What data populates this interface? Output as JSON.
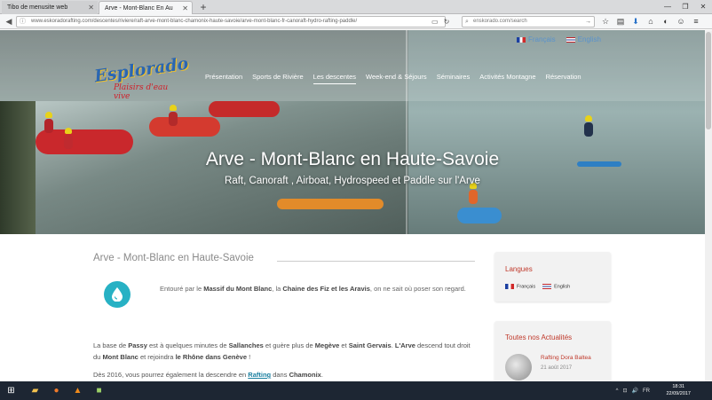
{
  "browser": {
    "tabs": [
      {
        "label": "Tibo de menusite web",
        "active": false
      },
      {
        "label": "Arve - Mont-Blanc En Au",
        "active": true
      }
    ],
    "new_tab_label": "+",
    "window_controls": [
      "—",
      "❐",
      "✕"
    ],
    "url": "www.eskoradorafting.com/descentes/riviere/raft-arve-mont-blanc-chamonix-haute-savoie/arve-mont-blanc-fr-canoraft-hydro-rafting-paddle/",
    "search_text": "enskorado.com/search",
    "icons": {
      "back": "back-icon",
      "reload": "reload-icon",
      "search": "search-icon"
    }
  },
  "site": {
    "languages": [
      {
        "label": "Français",
        "flag": "fr"
      },
      {
        "label": "English",
        "flag": "en"
      }
    ],
    "logo": {
      "line1": "Esplorado",
      "line2": "Plaisirs d'eau vive"
    },
    "nav": [
      {
        "label": "Présentation",
        "active": false
      },
      {
        "label": "Sports de Rivière",
        "active": false
      },
      {
        "label": "Les descentes",
        "active": true
      },
      {
        "label": "Week-end & Séjours",
        "active": false
      },
      {
        "label": "Séminaires",
        "active": false
      },
      {
        "label": "Activités Montagne",
        "active": false
      },
      {
        "label": "Réservation",
        "active": false
      }
    ],
    "hero_title": "Arve - Mont-Blanc en Haute-Savoie",
    "hero_subtitle": "Raft, Canoraft , Airboat, Hydrospeed et Paddle sur l'Arve"
  },
  "content": {
    "section_title": "Arve - Mont-Blanc en Haute-Savoie",
    "intro_a": "Entouré par le ",
    "intro_b": "Massif du Mont Blanc",
    "intro_c": ", la ",
    "intro_d": "Chaine des Fiz et les Aravis",
    "intro_e": ", on ne sait où poser son regard.",
    "p1_a": "La base de ",
    "p1_b": "Passy",
    "p1_c": " est à quelques minutes de ",
    "p1_d": "Sallanches",
    "p1_e": " et guère plus de ",
    "p1_f": "Megève",
    "p1_g": " et ",
    "p1_h": "Saint Gervais",
    "p1_i": ". ",
    "p1_j": "L'Arve",
    "p1_k": " descend tout droit du ",
    "p1_l": "Mont Blanc",
    "p1_m": " et rejoindra ",
    "p1_n": "le Rhône dans Genève",
    "p1_o": " !",
    "p2_a": "Dès 2016, vous pourrez également la descendre en ",
    "p2_b": "Rafting",
    "p2_c": " dans ",
    "p2_d": "Chamonix",
    "p2_e": "."
  },
  "sidebar": {
    "lang_widget_title": "Langues",
    "lang_widget_items": [
      "Français",
      "English"
    ],
    "news_widget_title": "Toutes nos Actualités",
    "news_item": "Rafting Dora Baltea",
    "news_date": "21 août 2017"
  },
  "taskbar": {
    "tray": [
      "^",
      "⊡",
      "🔊",
      "FR"
    ],
    "time": "18:31",
    "date": "22/09/2017"
  }
}
